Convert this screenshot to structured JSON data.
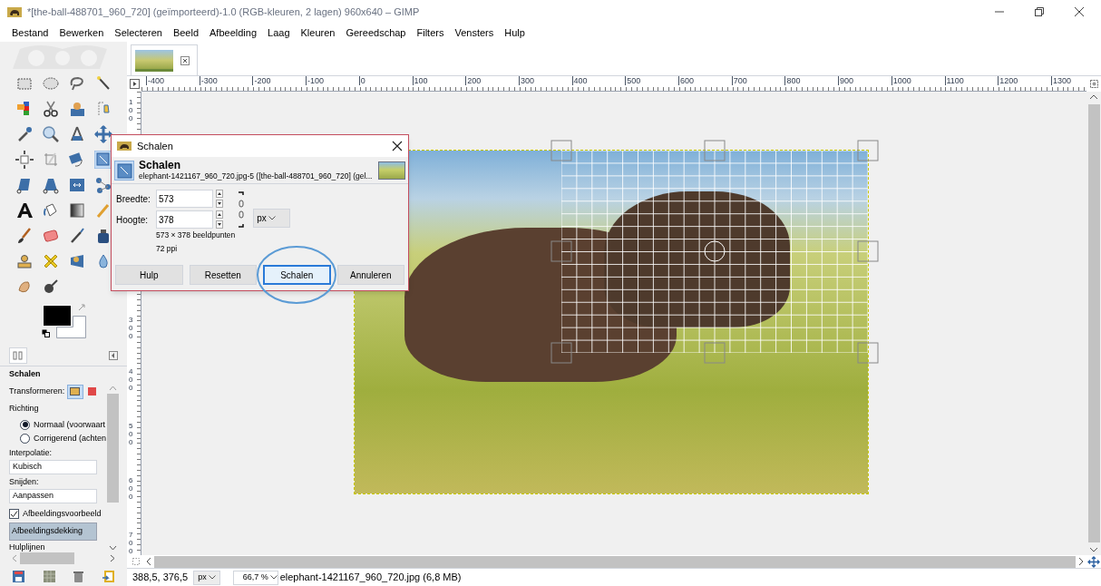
{
  "window": {
    "title": "*[the-ball-488701_960_720] (geïmporteerd)-1.0 (RGB-kleuren, 2 lagen) 960x640 – GIMP"
  },
  "menu": [
    "Bestand",
    "Bewerken",
    "Selecteren",
    "Beeld",
    "Afbeelding",
    "Laag",
    "Kleuren",
    "Gereedschap",
    "Filters",
    "Vensters",
    "Hulp"
  ],
  "rulers": {
    "horizontal": [
      "-400",
      "-300",
      "-200",
      "-100",
      "0",
      "100",
      "200",
      "300",
      "400",
      "500",
      "600",
      "700",
      "800",
      "900",
      "1000",
      "1100",
      "1200",
      "1300"
    ],
    "vertical": [
      "100",
      "300",
      "400",
      "500",
      "600",
      "700"
    ]
  },
  "tool_options": {
    "title": "Schalen",
    "transform_label": "Transformeren:",
    "direction_label": "Richting",
    "direction_options": [
      {
        "label": "Normaal (voorwaart",
        "selected": true
      },
      {
        "label": "Corrigerend (achten",
        "selected": false
      }
    ],
    "interpolation_label": "Interpolatie:",
    "interpolation": "Kubisch",
    "clipping_label": "Snijden:",
    "clipping": "Aanpassen",
    "preview": {
      "label": "Afbeeldingsvoorbeeld",
      "checked": true
    },
    "preview_mode": "Afbeeldingsdekking",
    "guides_label": "Hulplijnen"
  },
  "dialog": {
    "title": "Schalen",
    "heading": "Schalen",
    "subtitle": "elephant-1421167_960_720.jpg-5 ([the-ball-488701_960_720] (gel...",
    "fields": [
      {
        "label": "Breedte:",
        "value": "573"
      },
      {
        "label": "Hoogte:",
        "value": "378"
      }
    ],
    "unit": "px",
    "size_info": "573 × 378 beeldpunten",
    "resolution": "72 ppi",
    "buttons": [
      {
        "label": "Hulp",
        "selected": false
      },
      {
        "label": "Resetten",
        "selected": false
      },
      {
        "label": "Schalen",
        "selected": true
      },
      {
        "label": "Annuleren",
        "selected": false
      }
    ]
  },
  "status_bar": {
    "coordinates": "388,5, 376,5",
    "unit": "px",
    "zoom": "66,7 %",
    "info": "elephant-1421167_960_720.jpg (6,8 MB)"
  }
}
